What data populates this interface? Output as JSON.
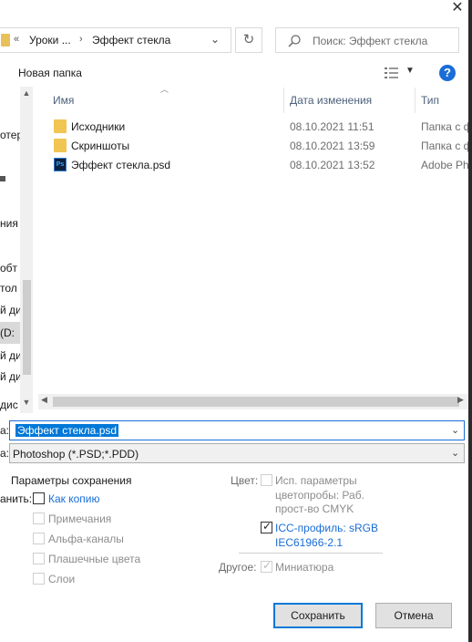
{
  "window": {
    "close_glyph": "✕"
  },
  "address_bar": {
    "chevrons": "«",
    "crumbs": [
      "Уроки ...",
      "Эффект стекла"
    ],
    "separator": "›",
    "dropdown_glyph": "⌄",
    "refresh_glyph": "↻"
  },
  "search": {
    "placeholder": "Поиск: Эффект стекла"
  },
  "toolbar": {
    "new_folder_label": "Новая папка",
    "help_glyph": "?",
    "view_dropdown_glyph": "▼"
  },
  "nav_pane": {
    "items": [
      "отер",
      "",
      "ния",
      "",
      "обт",
      "тол",
      "й ди",
      "(D:",
      "й ди",
      "й ди",
      "дис"
    ]
  },
  "columns": {
    "name": "Имя",
    "date": "Дата изменения",
    "type": "Тип"
  },
  "files": [
    {
      "name": "Исходники",
      "date": "08.10.2021 11:51",
      "type": "Папка с ф",
      "icon": "folder-icon"
    },
    {
      "name": "Скриншоты",
      "date": "08.10.2021 13:59",
      "type": "Папка с ф",
      "icon": "folder-icon"
    },
    {
      "name": "Эффект стекла.psd",
      "date": "08.10.2021 13:52",
      "type": "Adobe Ph",
      "icon": "psd-file-icon",
      "icon_text": "Ps"
    }
  ],
  "form": {
    "filename_label": "а:",
    "filename_value": "Эффект стекла.psd",
    "filetype_label": "а:",
    "filetype_value": "Photoshop (*.PSD;*.PDD)",
    "dropdown_glyph": "⌄"
  },
  "save_options": {
    "title": "Параметры сохранения",
    "save_label": "анить:",
    "as_copy": "Как копию",
    "notes": "Примечания",
    "alpha": "Альфа-каналы",
    "spot": "Плашечные цвета",
    "layers": "Слои",
    "color_label": "Цвет:",
    "proof_line1": "Исп. параметры",
    "proof_line2": "цветопробы:  Раб.",
    "proof_line3": "прост-во CMYK",
    "icc_line1": "ICC-профиль:  sRGB",
    "icc_line2": "IEC61966-2.1",
    "other_label": "Другое:",
    "thumbnail": "Миниатюра"
  },
  "buttons": {
    "save": "Сохранить",
    "cancel": "Отмена"
  },
  "colors": {
    "accent": "#0078d7",
    "link": "#1a6dd6",
    "folder": "#f0c552"
  }
}
